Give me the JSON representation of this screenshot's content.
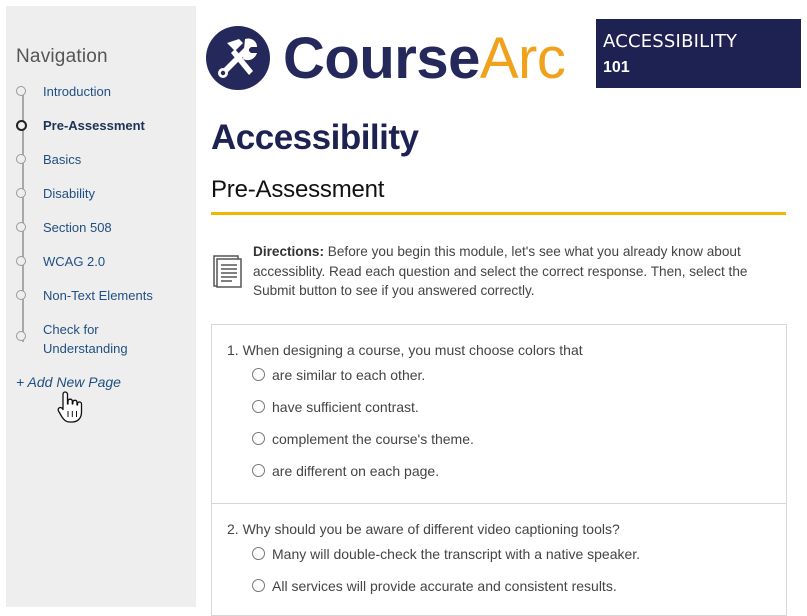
{
  "sidebar": {
    "title": "Navigation",
    "items": [
      {
        "label": "Introduction",
        "active": false
      },
      {
        "label": "Pre-Assessment",
        "active": true
      },
      {
        "label": "Basics",
        "active": false
      },
      {
        "label": "Disability",
        "active": false
      },
      {
        "label": "Section 508",
        "active": false
      },
      {
        "label": "WCAG 2.0",
        "active": false
      },
      {
        "label": "Non-Text Elements",
        "active": false
      },
      {
        "label": "Check for Understanding",
        "active": false
      }
    ],
    "add_page": "+ Add New Page"
  },
  "header": {
    "logo_part1": "Course",
    "logo_part2": "Arc",
    "logo_icon": "hammer-wrench-icon",
    "badge_line1": "ACCESSIBILITY",
    "badge_line2": "101"
  },
  "main": {
    "title": "Accessibility",
    "subtitle": "Pre-Assessment",
    "directions_label": "Directions:",
    "directions_text": " Before you begin this module, let's see what you already know about accessiblity. Read each question and select the correct response. Then, select the Submit button to see if you answered correctly.",
    "questions": [
      {
        "text": "1. When designing a course, you must choose colors that",
        "options": [
          "are similar to each other.",
          "have sufficient contrast.",
          "complement the course's theme.",
          "are different on each page."
        ]
      },
      {
        "text": "2. Why should you be aware of different video captioning tools?",
        "options": [
          "Many will double-check the transcript with a native speaker.",
          "All services will provide accurate and consistent results."
        ]
      }
    ]
  },
  "colors": {
    "brand_navy": "#1d2252",
    "brand_orange": "#f0a21b",
    "rule_yellow": "#f2b705",
    "sidebar_bg": "#eeeeee",
    "nav_link": "#1f4f82"
  }
}
